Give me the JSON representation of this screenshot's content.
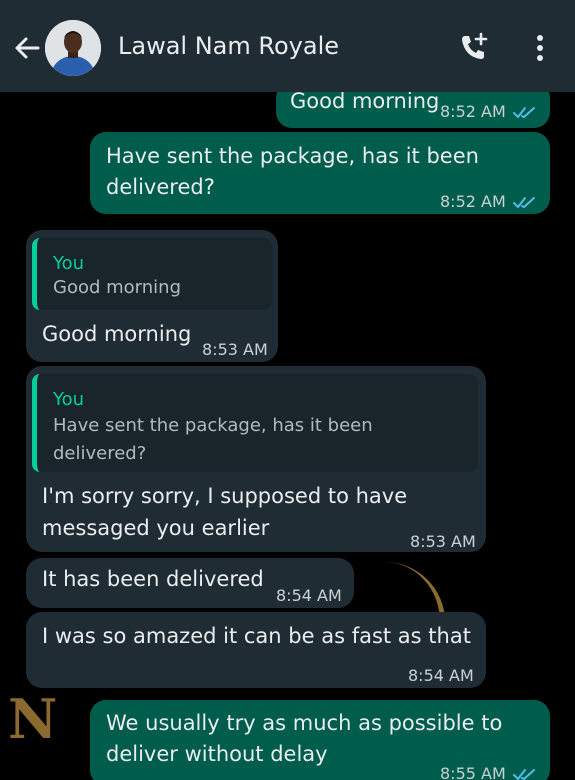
{
  "header": {
    "contact_name": "Lawal Nam Royale",
    "back_icon": "arrow-left-icon",
    "call_icon": "add-call-icon",
    "menu_icon": "more-vert-icon"
  },
  "watermark": "N",
  "messages": [
    {
      "direction": "out",
      "text": "Good morning",
      "time": "8:52 AM",
      "status": "read"
    },
    {
      "direction": "out",
      "text_line1": "Have sent the package, has it been",
      "text_line2": "delivered?",
      "time": "8:52 AM",
      "status": "read"
    },
    {
      "direction": "in",
      "quote_author": "You",
      "quote_text": "Good morning",
      "text": "Good morning",
      "time": "8:53 AM"
    },
    {
      "direction": "in",
      "quote_author": "You",
      "quote_line1": "Have sent the package, has it been",
      "quote_line2": "delivered?",
      "text_line1": "I'm sorry sorry, I supposed to have",
      "text_line2": "messaged you earlier",
      "time": "8:53 AM"
    },
    {
      "direction": "in",
      "text": "It has been delivered",
      "time": "8:54 AM"
    },
    {
      "direction": "in",
      "text": "I was so amazed it can be as fast as that",
      "time": "8:54 AM"
    },
    {
      "direction": "out",
      "text_line1": "We usually try as much as possible to",
      "text_line2": "deliver without delay",
      "time": "8:55 AM",
      "status": "read"
    }
  ],
  "colors": {
    "header_bg": "#1f2c34",
    "outgoing_bubble": "#005c4b",
    "incoming_bubble": "#202c33",
    "quote_accent": "#06cf9c",
    "read_ticks": "#53bdeb"
  }
}
